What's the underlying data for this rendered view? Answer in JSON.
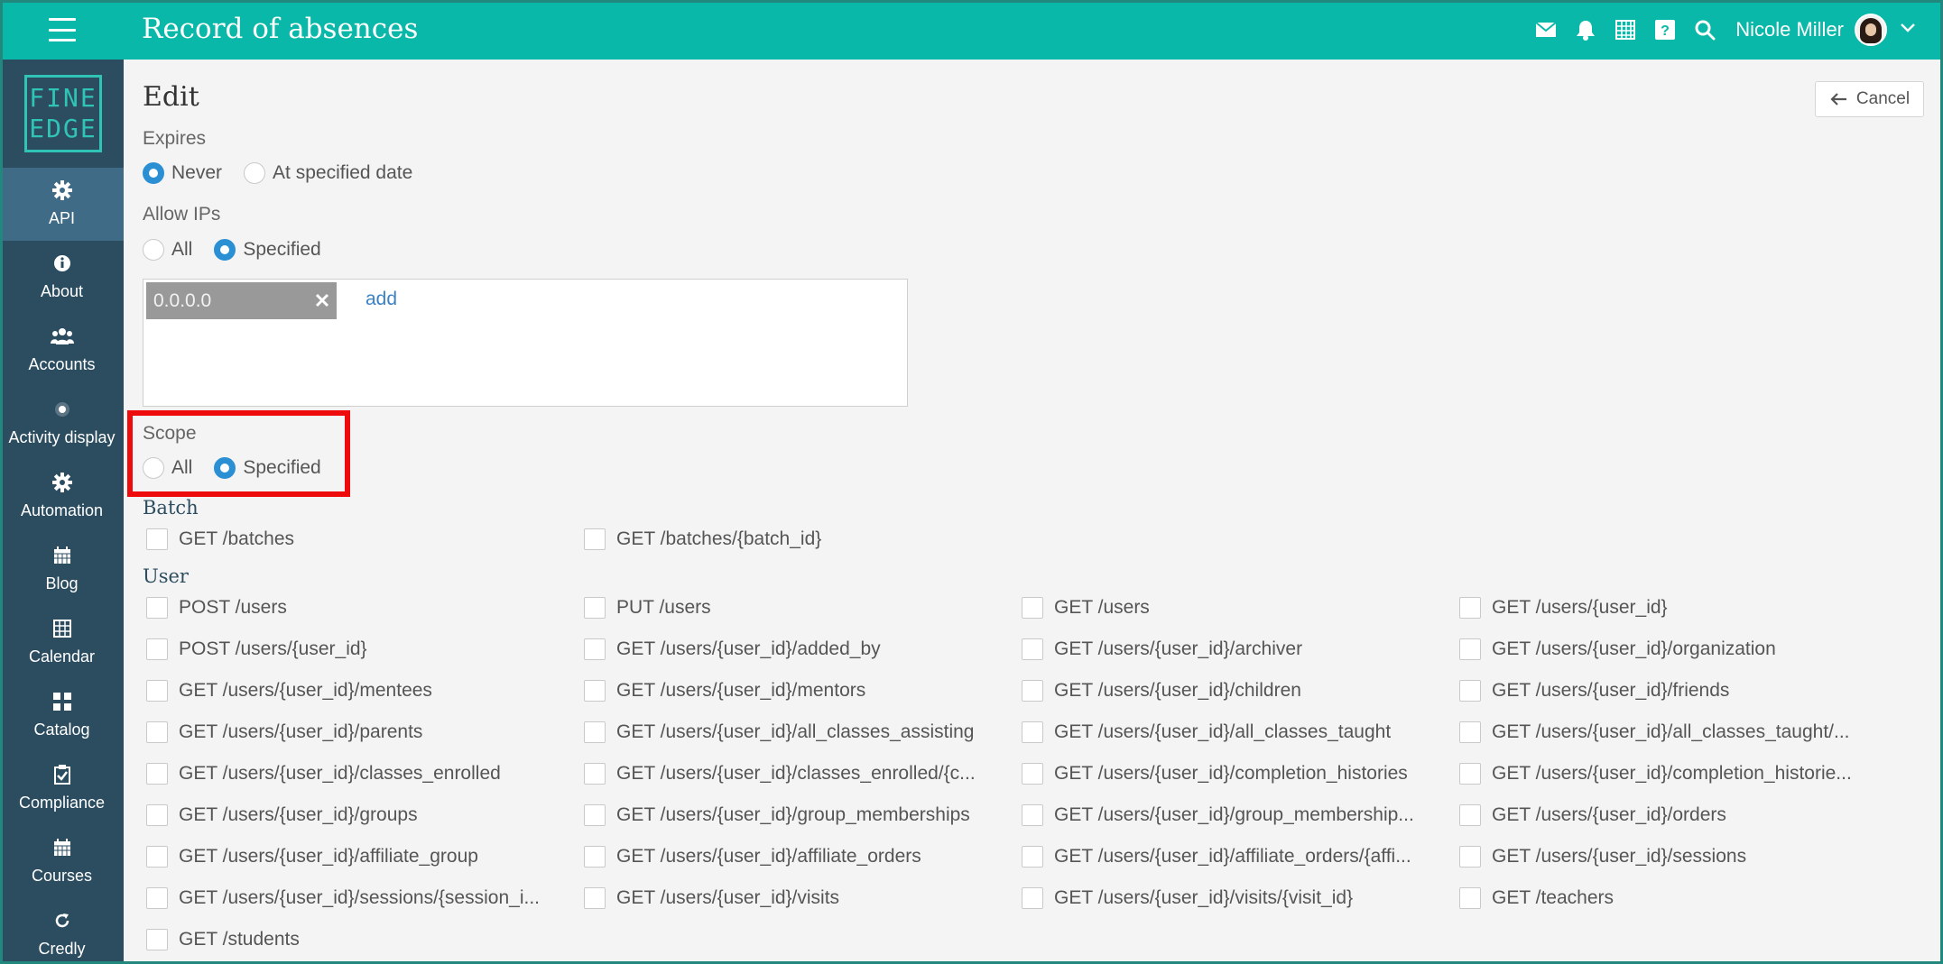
{
  "header": {
    "title": "Record of absences",
    "user_name": "Nicole Miller"
  },
  "sidebar": {
    "logo_line1": "FINE",
    "logo_line2": "EDGE",
    "items": [
      {
        "label": "API",
        "icon": "gear-icon",
        "active": true
      },
      {
        "label": "About",
        "icon": "info-icon"
      },
      {
        "label": "Accounts",
        "icon": "users-icon"
      },
      {
        "label": "Activity display",
        "icon": "dot-circle-icon"
      },
      {
        "label": "Automation",
        "icon": "gear-icon"
      },
      {
        "label": "Blog",
        "icon": "calendar-icon"
      },
      {
        "label": "Calendar",
        "icon": "grid-calendar-icon"
      },
      {
        "label": "Catalog",
        "icon": "catalog-icon"
      },
      {
        "label": "Compliance",
        "icon": "clipboard-check-icon"
      },
      {
        "label": "Courses",
        "icon": "calendar-icon"
      },
      {
        "label": "Credly",
        "icon": "refresh-icon"
      }
    ]
  },
  "page": {
    "title": "Edit",
    "cancel_label": "Cancel"
  },
  "expires": {
    "label": "Expires",
    "options": [
      "Never",
      "At specified date"
    ],
    "selected": "Never"
  },
  "allow_ips": {
    "label": "Allow IPs",
    "options": [
      "All",
      "Specified"
    ],
    "selected": "Specified",
    "ips": [
      "0.0.0.0"
    ],
    "add_label": "add"
  },
  "scope": {
    "label": "Scope",
    "options": [
      "All",
      "Specified"
    ],
    "selected": "Specified"
  },
  "batch": {
    "title": "Batch",
    "permissions": [
      "GET /batches",
      "GET /batches/{batch_id}"
    ]
  },
  "user": {
    "title": "User",
    "permissions": [
      "POST /users",
      "PUT /users",
      "GET /users",
      "GET /users/{user_id}",
      "POST /users/{user_id}",
      "GET /users/{user_id}/added_by",
      "GET /users/{user_id}/archiver",
      "GET /users/{user_id}/organization",
      "GET /users/{user_id}/mentees",
      "GET /users/{user_id}/mentors",
      "GET /users/{user_id}/children",
      "GET /users/{user_id}/friends",
      "GET /users/{user_id}/parents",
      "GET /users/{user_id}/all_classes_assisting",
      "GET /users/{user_id}/all_classes_taught",
      "GET /users/{user_id}/all_classes_taught/...",
      "GET /users/{user_id}/classes_enrolled",
      "GET /users/{user_id}/classes_enrolled/{c...",
      "GET /users/{user_id}/completion_histories",
      "GET /users/{user_id}/completion_historie...",
      "GET /users/{user_id}/groups",
      "GET /users/{user_id}/group_memberships",
      "GET /users/{user_id}/group_membership...",
      "GET /users/{user_id}/orders",
      "GET /users/{user_id}/affiliate_group",
      "GET /users/{user_id}/affiliate_orders",
      "GET /users/{user_id}/affiliate_orders/{affi...",
      "GET /users/{user_id}/sessions",
      "GET /users/{user_id}/sessions/{session_i...",
      "GET /users/{user_id}/visits",
      "GET /users/{user_id}/visits/{visit_id}",
      "GET /teachers",
      "GET /students"
    ]
  },
  "colors": {
    "topbar": "#09b8a8",
    "sidebar": "#2c4d60",
    "sidebar_active": "#3f6b86",
    "radio_selected": "#2b8fd4",
    "highlight": "#ee0b0b"
  }
}
